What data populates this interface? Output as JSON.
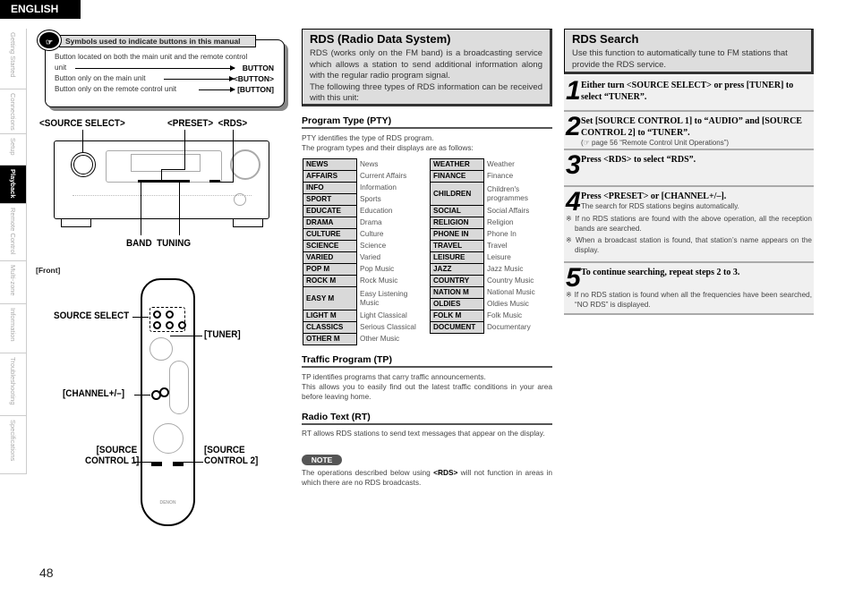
{
  "language_badge": "ENGLISH",
  "page_number": "48",
  "side_tabs": [
    {
      "label": "Getting Started",
      "active": false
    },
    {
      "label": "Connections",
      "active": false
    },
    {
      "label": "Setup",
      "active": false
    },
    {
      "label": "Playback",
      "active": true
    },
    {
      "label": "Remote Control",
      "active": false
    },
    {
      "label": "Multi-zone",
      "active": false
    },
    {
      "label": "Information",
      "active": false
    },
    {
      "label": "Troubleshooting",
      "active": false
    },
    {
      "label": "Specifications",
      "active": false
    }
  ],
  "symbols": {
    "title": "Symbols used to indicate buttons in this manual",
    "rows": [
      {
        "text": "Button located on both the main unit and the remote control",
        "text2": "unit",
        "symbol": "BUTTON"
      },
      {
        "text": "Button only on the main unit",
        "symbol": "<BUTTON>"
      },
      {
        "text": "Button only on the remote control unit",
        "symbol": "[BUTTON]"
      }
    ]
  },
  "main_unit": {
    "labels": {
      "source_select": "<SOURCE SELECT>",
      "preset_rds": "<PRESET>  <RDS>",
      "band_tuning": "BAND  TUNING"
    },
    "caption": "[Front]"
  },
  "remote": {
    "labels": {
      "source_select": "SOURCE SELECT",
      "tuner": "[TUNER]",
      "channel": "[CHANNEL+/–]",
      "sc1a": "[SOURCE",
      "sc1b": "CONTROL 1]",
      "sc2a": "[SOURCE",
      "sc2b": "CONTROL 2]"
    },
    "brand": "DENON"
  },
  "rds": {
    "title": "RDS (Radio Data System)",
    "intro1": "RDS (works only on the FM band) is a broadcasting service which allows a station to send additional information along with the regular radio program signal.",
    "intro2": "The following three types of RDS information can be received with this unit:",
    "pty": {
      "heading": "Program Type (PTY)",
      "text1": "PTY identifies the type of RDS program.",
      "text2": "The program types and their displays are as follows:"
    },
    "pty_left": [
      [
        "NEWS",
        "News"
      ],
      [
        "AFFAIRS",
        "Current Affairs"
      ],
      [
        "INFO",
        "Information"
      ],
      [
        "SPORT",
        "Sports"
      ],
      [
        "EDUCATE",
        "Education"
      ],
      [
        "DRAMA",
        "Drama"
      ],
      [
        "CULTURE",
        "Culture"
      ],
      [
        "SCIENCE",
        "Science"
      ],
      [
        "VARIED",
        "Varied"
      ],
      [
        "POP M",
        "Pop Music"
      ],
      [
        "ROCK M",
        "Rock Music"
      ],
      [
        "EASY M",
        "Easy Listening Music"
      ],
      [
        "LIGHT M",
        "Light Classical"
      ],
      [
        "CLASSICS",
        "Serious Classical"
      ],
      [
        "OTHER M",
        "Other Music"
      ]
    ],
    "pty_right": [
      [
        "WEATHER",
        "Weather"
      ],
      [
        "FINANCE",
        "Finance"
      ],
      [
        "CHILDREN",
        "Children's programmes"
      ],
      [
        "SOCIAL",
        "Social Affairs"
      ],
      [
        "RELIGION",
        "Religion"
      ],
      [
        "PHONE IN",
        "Phone In"
      ],
      [
        "TRAVEL",
        "Travel"
      ],
      [
        "LEISURE",
        "Leisure"
      ],
      [
        "JAZZ",
        "Jazz Music"
      ],
      [
        "COUNTRY",
        "Country Music"
      ],
      [
        "NATION M",
        "National Music"
      ],
      [
        "OLDIES",
        "Oldies Music"
      ],
      [
        "FOLK M",
        "Folk Music"
      ],
      [
        "DOCUMENT",
        "Documentary"
      ]
    ],
    "tp": {
      "heading": "Traffic Program (TP)",
      "text1": "TP identifies programs that carry traffic announcements.",
      "text2": "This allows you to easily find out the latest traffic conditions in your area before leaving home."
    },
    "rt": {
      "heading": "Radio Text (RT)",
      "text": "RT allows RDS stations to send text messages that appear on the display."
    },
    "note": {
      "label": "NOTE",
      "pre": "The operations described below using ",
      "key": "<RDS>",
      "post": " will not function in areas in which there are no RDS broadcasts."
    }
  },
  "rds_search": {
    "title": "RDS Search",
    "intro": "Use this function to automatically tune to FM stations that provide the RDS service.",
    "steps": [
      {
        "num": "1",
        "title": "Either turn <SOURCE SELECT> or press [TUNER] to select “TUNER”."
      },
      {
        "num": "2",
        "title": "Set [SOURCE CONTROL 1] to “AUDIO” and [SOURCE CONTROL 2] to “TUNER”.",
        "sub": "(☞ page 56 “Remote Control Unit Operations”)"
      },
      {
        "num": "3",
        "title": "Press <RDS> to select “RDS”."
      },
      {
        "num": "4",
        "title": "Press <PRESET> or [CHANNEL+/–].",
        "sub": "The search for RDS stations begins automatically.",
        "notes": [
          "※ If no RDS stations are found with the above operation, all the reception bands are searched.",
          "※ When a broadcast station is found, that station’s name appears on the display."
        ]
      },
      {
        "num": "5",
        "title": "To continue searching, repeat steps 2 to 3.",
        "notes": [
          "※ If no RDS station is found when all the frequencies have been searched, “NO RDS” is displayed."
        ]
      }
    ]
  }
}
